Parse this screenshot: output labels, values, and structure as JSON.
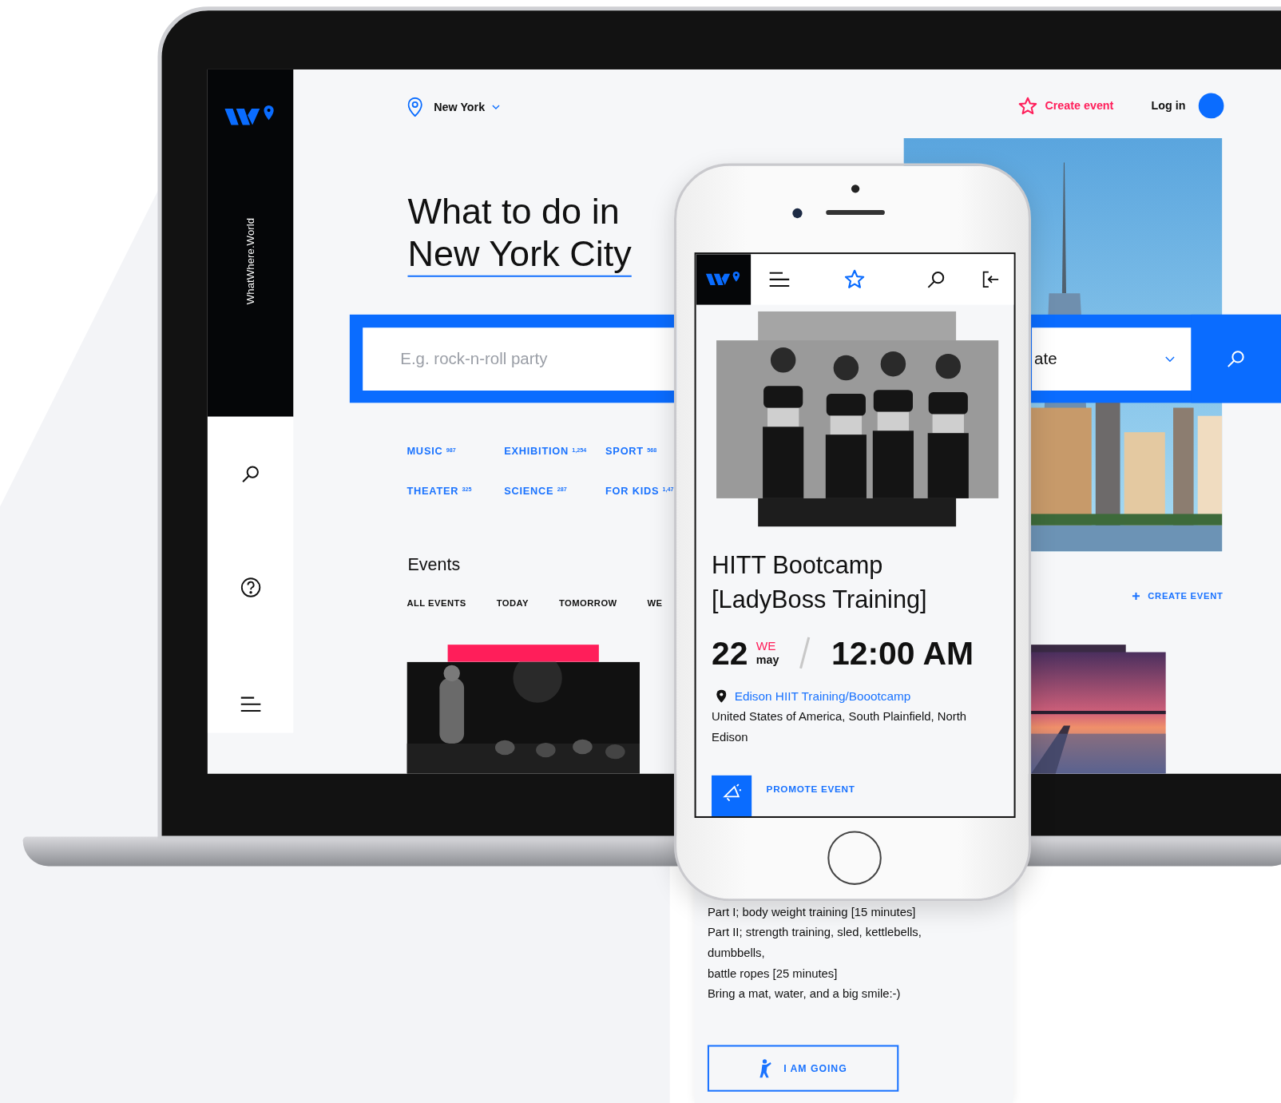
{
  "laptop": {
    "sidebar": {
      "brand": "WhatWhere.World"
    },
    "header": {
      "location": "New York",
      "create_event": "Create event",
      "login": "Log in"
    },
    "hero": {
      "title_lines": [
        "What to do in",
        "New York City"
      ],
      "search_placeholder": "E.g. rock-n-roll party",
      "date_select": "ate"
    },
    "categories": [
      {
        "label": "MUSIC",
        "count": "987"
      },
      {
        "label": "EXHIBITION",
        "count": "1,254"
      },
      {
        "label": "SPORT",
        "count": "568"
      },
      {
        "label": "THEATER",
        "count": "325"
      },
      {
        "label": "SCIENCE",
        "count": "287"
      },
      {
        "label": "FOR KIDS",
        "count": "1,47"
      }
    ],
    "events": {
      "heading": "Events",
      "tabs": [
        "ALL EVENTS",
        "TODAY",
        "TOMORROW",
        "WE"
      ],
      "create_event_link": "CREATE EVENT"
    }
  },
  "phone": {
    "event": {
      "title_lines": [
        "HITT Bootcamp",
        "[LadyBoss Training]"
      ],
      "day": "22",
      "weekday": "WE",
      "month": "may",
      "time": "12:00 AM",
      "venue": "Edison HIIT Training/Boootcamp",
      "address": "United States of America, South Plainfield, North Edison",
      "promote": "PROMOTE EVENT",
      "description": [
        "Part I; body weight training [15 minutes]",
        "Part II; strength training, sled, kettlebells,",
        "dumbbells,",
        "battle ropes [25 minutes]",
        "Bring a mat, water, and a big smile:-)"
      ],
      "going": "I AM GOING"
    }
  }
}
